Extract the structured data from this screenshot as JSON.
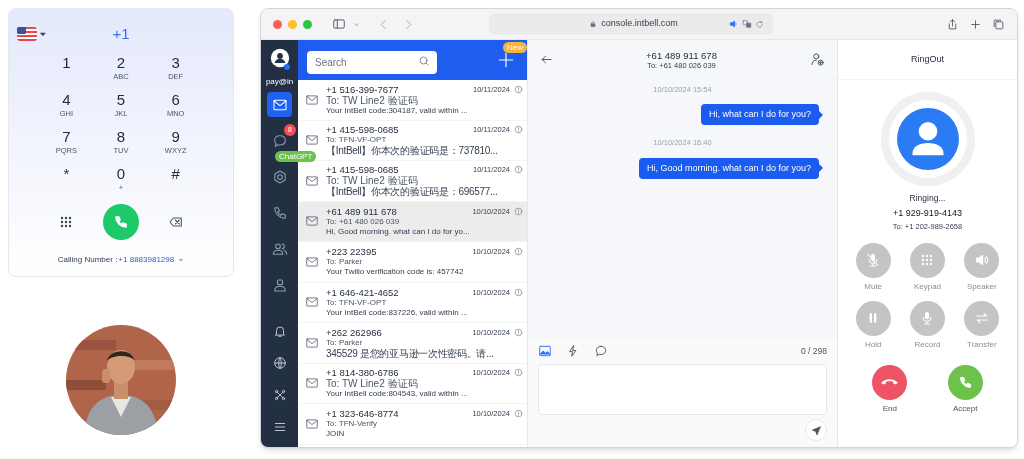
{
  "dialer": {
    "dial_code": "+1",
    "keys": [
      {
        "digit": "1"
      },
      {
        "digit": "2",
        "letters": "ABC"
      },
      {
        "digit": "3",
        "letters": "DEF"
      },
      {
        "digit": "4",
        "letters": "GHI"
      },
      {
        "digit": "5",
        "letters": "JKL"
      },
      {
        "digit": "6",
        "letters": "MNO"
      },
      {
        "digit": "7",
        "letters": "PQRS"
      },
      {
        "digit": "8",
        "letters": "TUV"
      },
      {
        "digit": "9",
        "letters": "WXYZ"
      },
      {
        "digit": "*"
      },
      {
        "digit": "0",
        "letters": "+"
      },
      {
        "digit": "#"
      }
    ],
    "calling_label": "Calling Number :",
    "calling_number": "+1 8883981298"
  },
  "browser": {
    "url": "console.intbell.com"
  },
  "sidebar": {
    "account": "pay@in",
    "items": [
      {
        "kind": "mail",
        "selected": true
      },
      {
        "kind": "chat",
        "selected": false,
        "badge": "8"
      },
      {
        "kind": "ai",
        "selected": false,
        "tooltip": "ChatGPT"
      },
      {
        "kind": "phone",
        "selected": false
      },
      {
        "kind": "contacts",
        "selected": false
      },
      {
        "kind": "user",
        "selected": false
      }
    ],
    "bottom_items": [
      {
        "kind": "bell"
      },
      {
        "kind": "globe"
      },
      {
        "kind": "shortcut"
      },
      {
        "kind": "menu"
      }
    ]
  },
  "conversations": {
    "search_placeholder": "Search",
    "new_badge": "New",
    "rows": [
      {
        "number": "+1 516-399-7677",
        "to": "To: TW Line2 验证码",
        "date": "10/11/2024",
        "preview": "Your IntBell code:304187, valid within ...",
        "selected": false
      },
      {
        "number": "+1 415-598-0685",
        "to": "To: TFN-VF-OPT",
        "date": "10/11/2024",
        "preview": "【IntBell】你本次的验证码是：737810...",
        "selected": false
      },
      {
        "number": "+1 415-598-0685",
        "to": "To: TW Line2 验证码",
        "date": "10/11/2024",
        "preview": "【IntBell】你本次的验证码是：696577...",
        "selected": false
      },
      {
        "number": "+61 489 911 678",
        "to": "To: +61 480 026 039",
        "date": "10/10/2024",
        "preview": "Hi, Good morning. what can I do for yo...",
        "selected": true
      },
      {
        "number": "+223 22395",
        "to": "To: Parker",
        "date": "10/10/2024",
        "preview": "Your Twilio verification code is: 457742",
        "selected": false
      },
      {
        "number": "+1 646-421-4652",
        "to": "To: TFN-VF-OPT",
        "date": "10/10/2024",
        "preview": "Your IntBell code:837226, valid within ...",
        "selected": false
      },
      {
        "number": "+262 262966",
        "to": "To: Parker",
        "date": "10/10/2024",
        "preview": "345529 是您的亚马逊一次性密码。请...",
        "selected": false
      },
      {
        "number": "+1 814-380-6786",
        "to": "To: TW Line2 验证码",
        "date": "10/10/2024",
        "preview": "Your IntBell code:804543, valid within ...",
        "selected": false
      },
      {
        "number": "+1 323-646-8774",
        "to": "To: TFN-Verify",
        "date": "10/10/2024",
        "preview": "JOIN",
        "selected": false
      }
    ]
  },
  "chat": {
    "title": "+61 489 911 678",
    "to": "To: +61 480 026 039",
    "messages": [
      {
        "time": "10/10/2024 15:54",
        "text": "Hi, what can I do for you?"
      },
      {
        "time": "10/10/2024 16:40",
        "text": "Hi, Good morning. what can I do for you?"
      }
    ],
    "counter": "0 / 298"
  },
  "call": {
    "title": "RingOut",
    "status": "Ringing...",
    "number": "+1 929-919-4143",
    "to": "To: +1 202-989-2658",
    "controls": [
      {
        "kind": "mute",
        "label": "Mute",
        "disabled": true
      },
      {
        "kind": "keypad",
        "label": "Keypad",
        "disabled": true
      },
      {
        "kind": "speaker",
        "label": "Speaker",
        "disabled": true
      },
      {
        "kind": "hold",
        "label": "Hold",
        "disabled": true
      },
      {
        "kind": "record",
        "label": "Record",
        "disabled": true
      },
      {
        "kind": "transfer",
        "label": "Transfer",
        "disabled": true
      }
    ],
    "actions": [
      {
        "kind": "end",
        "label": "End"
      },
      {
        "kind": "accept",
        "label": "Accept"
      }
    ]
  }
}
